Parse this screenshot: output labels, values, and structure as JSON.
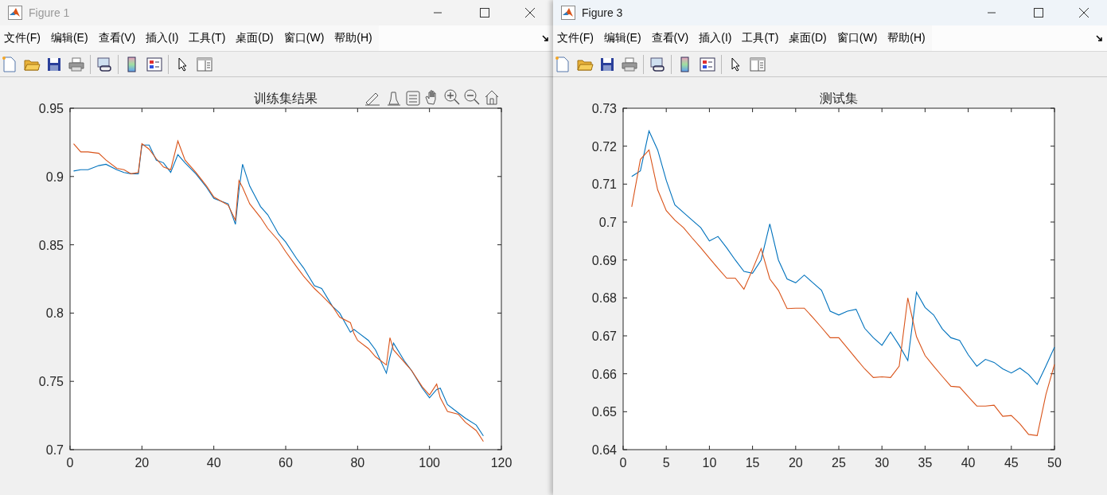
{
  "windows": [
    {
      "title": "Figure 1",
      "active": false,
      "axes_toolbar": true,
      "menu": [
        "文件(F)",
        "编辑(E)",
        "查看(V)",
        "插入(I)",
        "工具(T)",
        "桌面(D)",
        "窗口(W)",
        "帮助(H)"
      ],
      "chart_data": {
        "type": "line",
        "title": "训练集结果",
        "x": [
          1,
          3,
          5,
          8,
          10,
          13,
          15,
          17,
          19,
          20,
          22,
          24,
          26,
          28,
          30,
          32,
          35,
          38,
          40,
          42,
          44,
          46,
          47,
          48,
          50,
          53,
          55,
          58,
          60,
          63,
          65,
          68,
          70,
          73,
          75,
          78,
          79,
          80,
          83,
          85,
          88,
          89,
          90,
          93,
          95,
          98,
          100,
          102,
          103,
          105,
          108,
          110,
          113,
          115
        ],
        "series": [
          {
            "color": "#0072bd",
            "values": [
              0.904,
              0.905,
              0.905,
              0.908,
              0.909,
              0.905,
              0.903,
              0.902,
              0.902,
              0.923,
              0.923,
              0.912,
              0.91,
              0.903,
              0.916,
              0.91,
              0.902,
              0.892,
              0.884,
              0.882,
              0.88,
              0.865,
              0.89,
              0.909,
              0.893,
              0.878,
              0.872,
              0.858,
              0.852,
              0.84,
              0.833,
              0.82,
              0.818,
              0.805,
              0.8,
              0.786,
              0.788,
              0.786,
              0.78,
              0.773,
              0.756,
              0.768,
              0.778,
              0.765,
              0.758,
              0.745,
              0.738,
              0.744,
              0.745,
              0.733,
              0.727,
              0.723,
              0.718,
              0.71
            ]
          },
          {
            "color": "#d95319",
            "values": [
              0.924,
              0.918,
              0.918,
              0.917,
              0.912,
              0.906,
              0.905,
              0.902,
              0.903,
              0.924,
              0.92,
              0.913,
              0.907,
              0.905,
              0.926,
              0.912,
              0.903,
              0.893,
              0.885,
              0.882,
              0.879,
              0.868,
              0.897,
              0.892,
              0.88,
              0.87,
              0.862,
              0.853,
              0.845,
              0.834,
              0.827,
              0.818,
              0.813,
              0.805,
              0.797,
              0.793,
              0.785,
              0.78,
              0.774,
              0.768,
              0.762,
              0.782,
              0.773,
              0.764,
              0.758,
              0.746,
              0.74,
              0.748,
              0.738,
              0.728,
              0.726,
              0.72,
              0.714,
              0.706
            ]
          }
        ],
        "xlim": [
          0,
          120
        ],
        "ylim": [
          0.7,
          0.95
        ],
        "xticks": [
          0,
          20,
          40,
          60,
          80,
          100,
          120
        ],
        "yticks": [
          0.7,
          0.75,
          0.8,
          0.85,
          0.9,
          0.95
        ]
      }
    },
    {
      "title": "Figure 3",
      "active": true,
      "menu": [
        "文件(F)",
        "编辑(E)",
        "查看(V)",
        "插入(I)",
        "工具(T)",
        "桌面(D)",
        "窗口(W)",
        "帮助(H)"
      ],
      "chart_data": {
        "type": "line",
        "title": "测试集",
        "x": [
          1,
          2,
          3,
          4,
          5,
          6,
          7,
          8,
          9,
          10,
          11,
          12,
          13,
          14,
          15,
          16,
          17,
          18,
          19,
          20,
          21,
          22,
          23,
          24,
          25,
          26,
          27,
          28,
          29,
          30,
          31,
          32,
          33,
          34,
          35,
          36,
          37,
          38,
          39,
          40,
          41,
          42,
          43,
          44,
          45,
          46,
          47,
          48,
          49,
          50
        ],
        "series": [
          {
            "color": "#0072bd",
            "values": [
              0.712,
              0.7135,
              0.724,
              0.719,
              0.711,
              0.7045,
              0.7025,
              0.7005,
              0.6985,
              0.695,
              0.6962,
              0.6932,
              0.69,
              0.687,
              0.6865,
              0.69,
              0.6995,
              0.69,
              0.685,
              0.684,
              0.686,
              0.684,
              0.682,
              0.6765,
              0.6755,
              0.6765,
              0.677,
              0.672,
              0.6695,
              0.6675,
              0.671,
              0.6675,
              0.6635,
              0.6815,
              0.6775,
              0.6755,
              0.6718,
              0.6695,
              0.6688,
              0.665,
              0.662,
              0.6638,
              0.663,
              0.6613,
              0.6602,
              0.6615,
              0.6598,
              0.6572,
              0.662,
              0.667
            ]
          },
          {
            "color": "#d95319",
            "values": [
              0.704,
              0.7165,
              0.719,
              0.7085,
              0.703,
              0.7005,
              0.6985,
              0.6958,
              0.6932,
              0.6905,
              0.6878,
              0.6852,
              0.6852,
              0.6823,
              0.6875,
              0.693,
              0.685,
              0.682,
              0.6772,
              0.6773,
              0.6773,
              0.6748,
              0.6722,
              0.6695,
              0.6695,
              0.6668,
              0.664,
              0.6613,
              0.659,
              0.6592,
              0.659,
              0.662,
              0.68,
              0.6698,
              0.6648,
              0.662,
              0.6593,
              0.6567,
              0.6565,
              0.654,
              0.6515,
              0.6515,
              0.6517,
              0.6488,
              0.649,
              0.6468,
              0.644,
              0.6437,
              0.6545,
              0.6625
            ]
          }
        ],
        "xlim": [
          0,
          50
        ],
        "ylim": [
          0.64,
          0.73
        ],
        "xticks": [
          0,
          5,
          10,
          15,
          20,
          25,
          30,
          35,
          40,
          45,
          50
        ],
        "yticks": [
          0.64,
          0.65,
          0.66,
          0.67,
          0.68,
          0.69,
          0.7,
          0.71,
          0.72,
          0.73
        ]
      }
    }
  ]
}
